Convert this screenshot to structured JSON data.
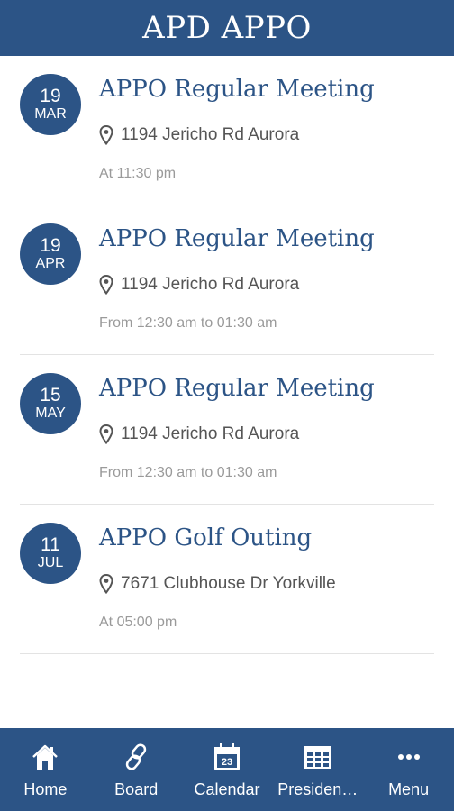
{
  "header": {
    "title": "APD APPO"
  },
  "events": [
    {
      "day": "19",
      "month": "MAR",
      "title": "APPO Regular Meeting",
      "location": "1194 Jericho Rd Aurora",
      "time": "At  11:30 pm"
    },
    {
      "day": "19",
      "month": "APR",
      "title": "APPO Regular Meeting",
      "location": "1194 Jericho Rd Aurora",
      "time": "From 12:30 am to 01:30 am"
    },
    {
      "day": "15",
      "month": "MAY",
      "title": "APPO Regular Meeting",
      "location": "1194 Jericho Rd Aurora",
      "time": "From 12:30 am to 01:30 am"
    },
    {
      "day": "11",
      "month": "JUL",
      "title": "APPO Golf Outing",
      "location": "7671 Clubhouse Dr Yorkville",
      "time": "At  05:00 pm"
    }
  ],
  "tabs": [
    {
      "label": "Home",
      "icon": "home-icon"
    },
    {
      "label": "Board",
      "icon": "link-icon"
    },
    {
      "label": "Calendar",
      "icon": "calendar-icon",
      "calendar_day": "23"
    },
    {
      "label": "Presiden…",
      "icon": "table-icon"
    },
    {
      "label": "Menu",
      "icon": "more-icon"
    }
  ],
  "colors": {
    "brand": "#2c5486",
    "location_text": "#555555",
    "time_text": "#9a9a9a"
  }
}
